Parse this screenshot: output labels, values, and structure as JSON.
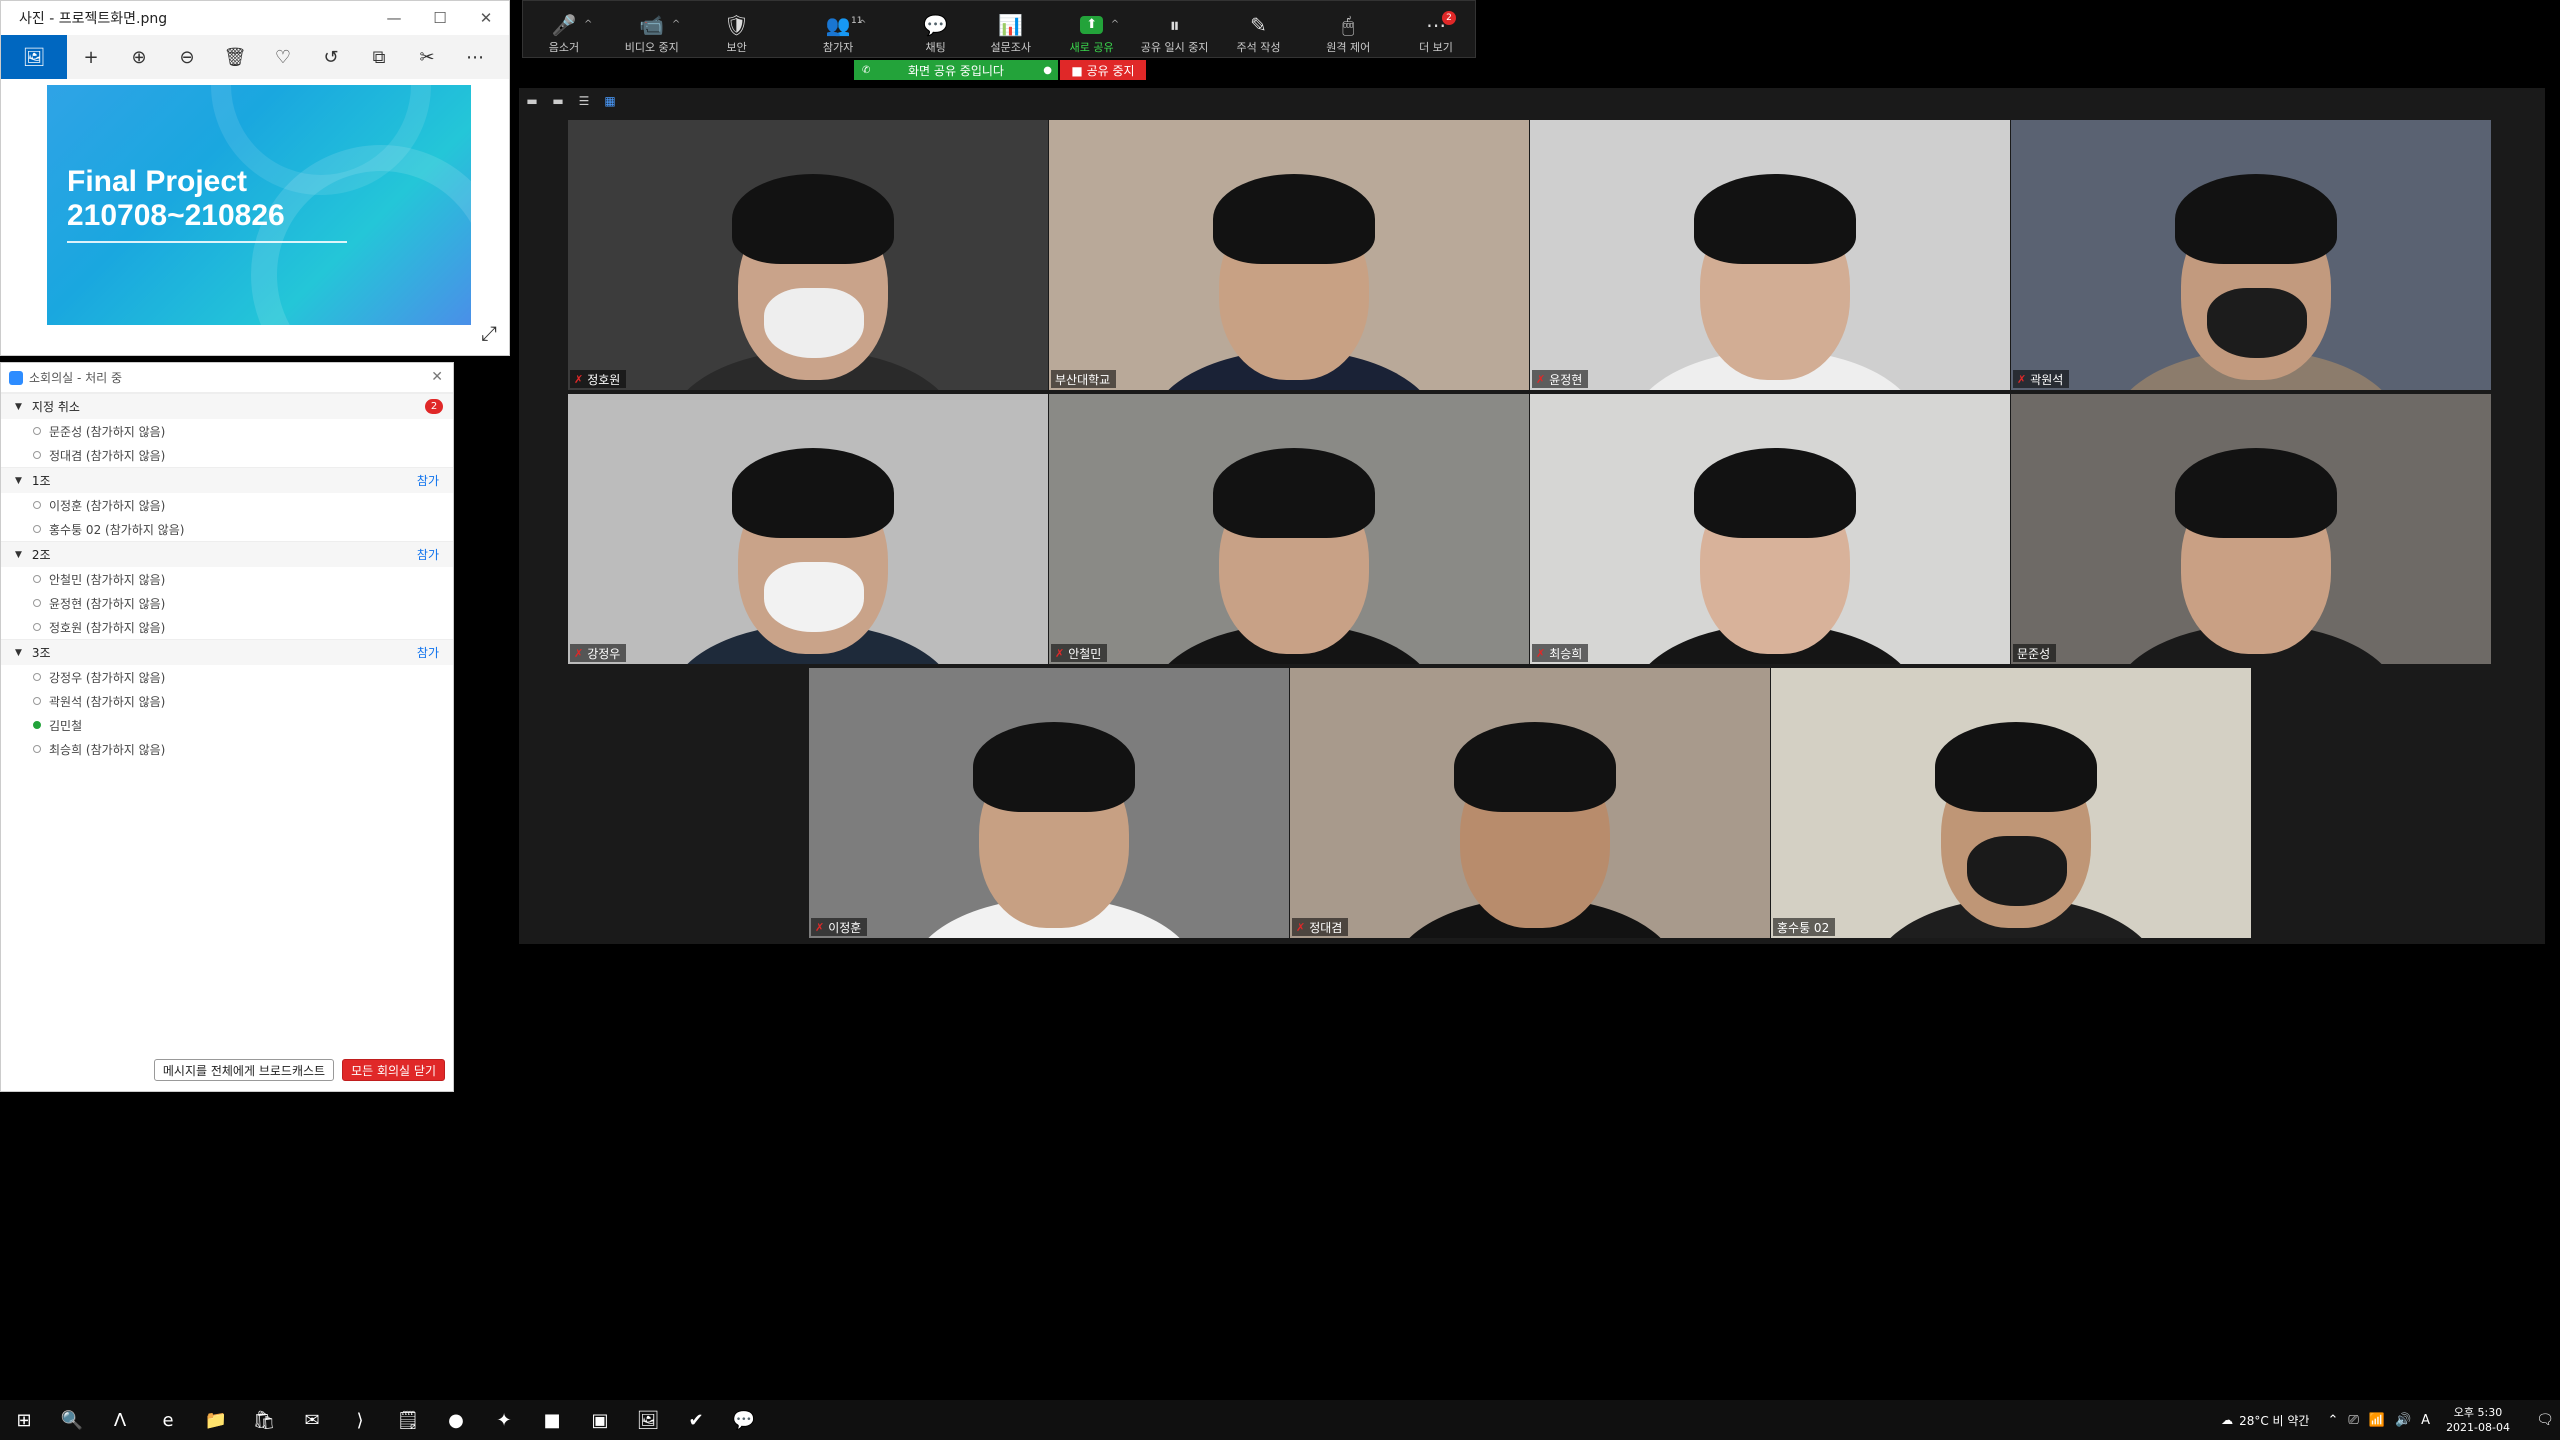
{
  "photos": {
    "title": "사진 - 프로젝트화면.png",
    "window_controls": [
      "—",
      "☐",
      "✕"
    ],
    "toolbar": [
      "🖼",
      "+",
      "⊕",
      "⊖",
      "🗑",
      "♡",
      "↺",
      "⧉",
      "✂",
      "⋯"
    ],
    "slide_title_line1": "Final Project",
    "slide_title_line2": "210708~210826",
    "expand_icon": "⤢"
  },
  "breakout": {
    "title": "소회의실 - 처리 중",
    "close": "✕",
    "groups": [
      {
        "name": "지정 취소",
        "badge": "2",
        "join": "",
        "members": [
          {
            "name": "문준성 (참가하지 않음)",
            "online": false
          },
          {
            "name": "정대겸 (참가하지 않음)",
            "online": false
          }
        ]
      },
      {
        "name": "1조",
        "badge": "",
        "join": "참가",
        "members": [
          {
            "name": "이정훈 (참가하지 않음)",
            "online": false
          },
          {
            "name": "홍수퉁 02 (참가하지 않음)",
            "online": false
          }
        ]
      },
      {
        "name": "2조",
        "badge": "",
        "join": "참가",
        "members": [
          {
            "name": "안철민 (참가하지 않음)",
            "online": false
          },
          {
            "name": "윤정현 (참가하지 않음)",
            "online": false
          },
          {
            "name": "정호원 (참가하지 않음)",
            "online": false
          }
        ]
      },
      {
        "name": "3조",
        "badge": "",
        "join": "참가",
        "members": [
          {
            "name": "강정우 (참가하지 않음)",
            "online": false
          },
          {
            "name": "곽원석 (참가하지 않음)",
            "online": false
          },
          {
            "name": "김민철",
            "online": true
          },
          {
            "name": "최승희 (참가하지 않음)",
            "online": false
          }
        ]
      }
    ],
    "broadcast_button": "메시지를 전체에게 브로드캐스트",
    "close_all_button": "모든 회의실 닫기"
  },
  "zoom_toolbar": {
    "items": [
      {
        "icon": "🎤",
        "label": "음소거",
        "count": "",
        "badge": "",
        "chevron": true,
        "green": false,
        "width": 84
      },
      {
        "icon": "📹",
        "label": "비디오 중지",
        "count": "",
        "badge": "",
        "chevron": true,
        "green": false,
        "width": 96
      },
      {
        "icon": "🛡",
        "label": "보안",
        "count": "",
        "badge": "",
        "chevron": false,
        "green": false,
        "width": 78
      },
      {
        "icon": "👥",
        "label": "참가자",
        "count": "11",
        "badge": "",
        "chevron": true,
        "green": false,
        "width": 130
      },
      {
        "icon": "💬",
        "label": "채팅",
        "count": "",
        "badge": "",
        "chevron": false,
        "green": false,
        "width": 70
      },
      {
        "icon": "📊",
        "label": "설문조사",
        "count": "",
        "badge": "",
        "chevron": false,
        "green": false,
        "width": 84
      },
      {
        "icon": "⬆",
        "label": "새로 공유",
        "count": "",
        "badge": "",
        "chevron": true,
        "green": true,
        "width": 82
      },
      {
        "icon": "⏸",
        "label": "공유 일시 중지",
        "count": "",
        "badge": "",
        "chevron": false,
        "green": false,
        "width": 88
      },
      {
        "icon": "✎",
        "label": "주석 작성",
        "count": "",
        "badge": "",
        "chevron": false,
        "green": false,
        "width": 84
      },
      {
        "icon": "🖱",
        "label": "원격 제어",
        "count": "",
        "badge": "",
        "chevron": false,
        "green": false,
        "width": 100
      },
      {
        "icon": "⋯",
        "label": "더 보기",
        "count": "",
        "badge": "2",
        "chevron": false,
        "green": false,
        "width": 80
      }
    ]
  },
  "share_banner": {
    "sharing_text": "화면 공유 중입니다",
    "stop_text": "■ 공유 중지"
  },
  "gallery": {
    "view_icons": [
      "▬",
      "▬",
      "☰",
      "▦"
    ],
    "tiles": [
      {
        "name": "정호원",
        "muted": true,
        "speaking": false,
        "bg": "#3c3c3c",
        "skin": "#c9a38a",
        "shirt": "#2a2a2a",
        "mask": "#eeeeee"
      },
      {
        "name": "부산대학교",
        "muted": false,
        "speaking": false,
        "bg": "#b9a999",
        "skin": "#c8a184",
        "shirt": "#1a2236",
        "mask": ""
      },
      {
        "name": "윤정현",
        "muted": true,
        "speaking": false,
        "bg": "#cfcfcf",
        "skin": "#d2ad94",
        "shirt": "#eeeeee",
        "mask": ""
      },
      {
        "name": "곽원석",
        "muted": true,
        "speaking": false,
        "bg": "#5a6272",
        "skin": "#c29a7e",
        "shirt": "#8c7c6c",
        "mask": "#1c1c1c"
      },
      {
        "name": "강정우",
        "muted": true,
        "speaking": false,
        "bg": "#bcbcbc",
        "skin": "#c9a389",
        "shirt": "#1e2a3a",
        "mask": "#f2f2f2"
      },
      {
        "name": "안철민",
        "muted": true,
        "speaking": false,
        "bg": "#8a8a86",
        "skin": "#c8a186",
        "shirt": "#141414",
        "mask": ""
      },
      {
        "name": "최승희",
        "muted": true,
        "speaking": false,
        "bg": "#d6d6d4",
        "skin": "#d8b29a",
        "shirt": "#151515",
        "mask": ""
      },
      {
        "name": "문준성",
        "muted": false,
        "speaking": true,
        "bg": "#6e6a66",
        "skin": "#c9a084",
        "shirt": "#1a1a1a",
        "mask": ""
      },
      {
        "name": "이정훈",
        "muted": true,
        "speaking": false,
        "bg": "#7d7d7d",
        "skin": "#c7a083",
        "shirt": "#f2f2f2",
        "mask": ""
      },
      {
        "name": "정대겸",
        "muted": true,
        "speaking": false,
        "bg": "#a89a8c",
        "skin": "#b88c6c",
        "shirt": "#121212",
        "mask": ""
      },
      {
        "name": "홍수퉁 02",
        "muted": false,
        "speaking": false,
        "bg": "#d4d0c4",
        "skin": "#bf9676",
        "shirt": "#1e1e1e",
        "mask": "#1a1a1a"
      }
    ]
  },
  "taskbar": {
    "icons": [
      "⊞",
      "🔍",
      "Λ",
      "e",
      "📁",
      "🛍",
      "✉",
      "⟩",
      "🗒",
      "●",
      "✦",
      "■",
      "▣",
      "🖼",
      "✔",
      "💬"
    ],
    "weather": "28°C 비 약간",
    "sys_icons": [
      "⌃",
      "⎚",
      "📶",
      "🔊",
      "A"
    ],
    "time": "오후 5:30",
    "date": "2021-08-04",
    "notification_icon": "🗨"
  }
}
